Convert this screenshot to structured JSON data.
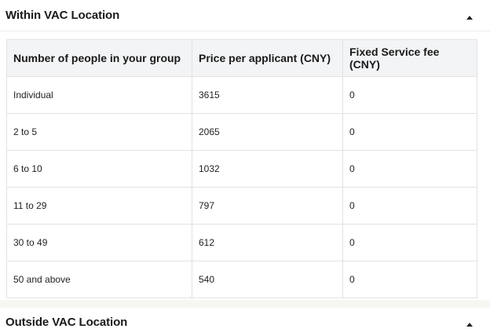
{
  "within": {
    "title": "Within VAC Location",
    "columns": [
      "Number of people in your group",
      "Price per applicant (CNY)",
      "Fixed Service fee (CNY)"
    ],
    "rows": [
      [
        "Individual",
        "3615",
        "0"
      ],
      [
        "2 to 5",
        "2065",
        "0"
      ],
      [
        "6 to 10",
        "1032",
        "0"
      ],
      [
        "11 to 29",
        "797",
        "0"
      ],
      [
        "30 to 49",
        "612",
        "0"
      ],
      [
        "50 and above",
        "540",
        "0"
      ]
    ]
  },
  "outside": {
    "title": "Outside VAC Location"
  },
  "icons": {
    "collapse": "chevron-up-icon"
  }
}
